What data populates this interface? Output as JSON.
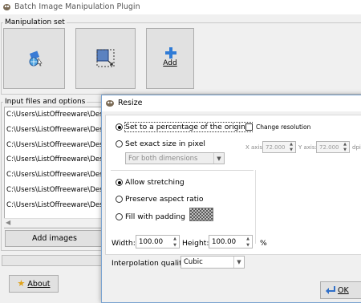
{
  "app": {
    "title": "Batch Image Manipulation Plugin"
  },
  "manipulation": {
    "legend": "Manipulation set",
    "add_label": "Add"
  },
  "input": {
    "legend": "Input files and options",
    "files": [
      "C:\\Users\\ListOffreeware\\Deskt",
      "C:\\Users\\ListOffreeware\\Deskt",
      "C:\\Users\\ListOffreeware\\Deskt",
      "C:\\Users\\ListOffreeware\\Deskt",
      "C:\\Users\\ListOffreeware\\Deskt",
      "C:\\Users\\ListOffreeware\\Deskt",
      "C:\\Users\\ListOffreeware\\Deskt",
      "C:\\Users\\ListOffreeware\\Deskt"
    ],
    "add_images_label": "Add images"
  },
  "footer": {
    "about_label": "About",
    "ok_label": "OK"
  },
  "resize": {
    "title": "Resize",
    "opt_percentage": "Set to a percentage of the original",
    "change_resolution": "Change resolution",
    "opt_exact": "Set exact size in pixel",
    "dimension_select": "For both dimensions",
    "x_axis_label": "X axis:",
    "x_axis_value": "72.000",
    "y_axis_label": "Y axis:",
    "y_axis_value": "72.000",
    "dpi_label": "dpi",
    "allow_stretching": "Allow stretching",
    "preserve_aspect": "Preserve aspect ratio",
    "fill_padding": "Fill with padding",
    "width_label": "Width:",
    "width_value": "100.00",
    "height_label": "Height:",
    "height_value": "100.00",
    "unit": "%",
    "interp_label": "Interpolation quality",
    "interp_value": "Cubic"
  }
}
